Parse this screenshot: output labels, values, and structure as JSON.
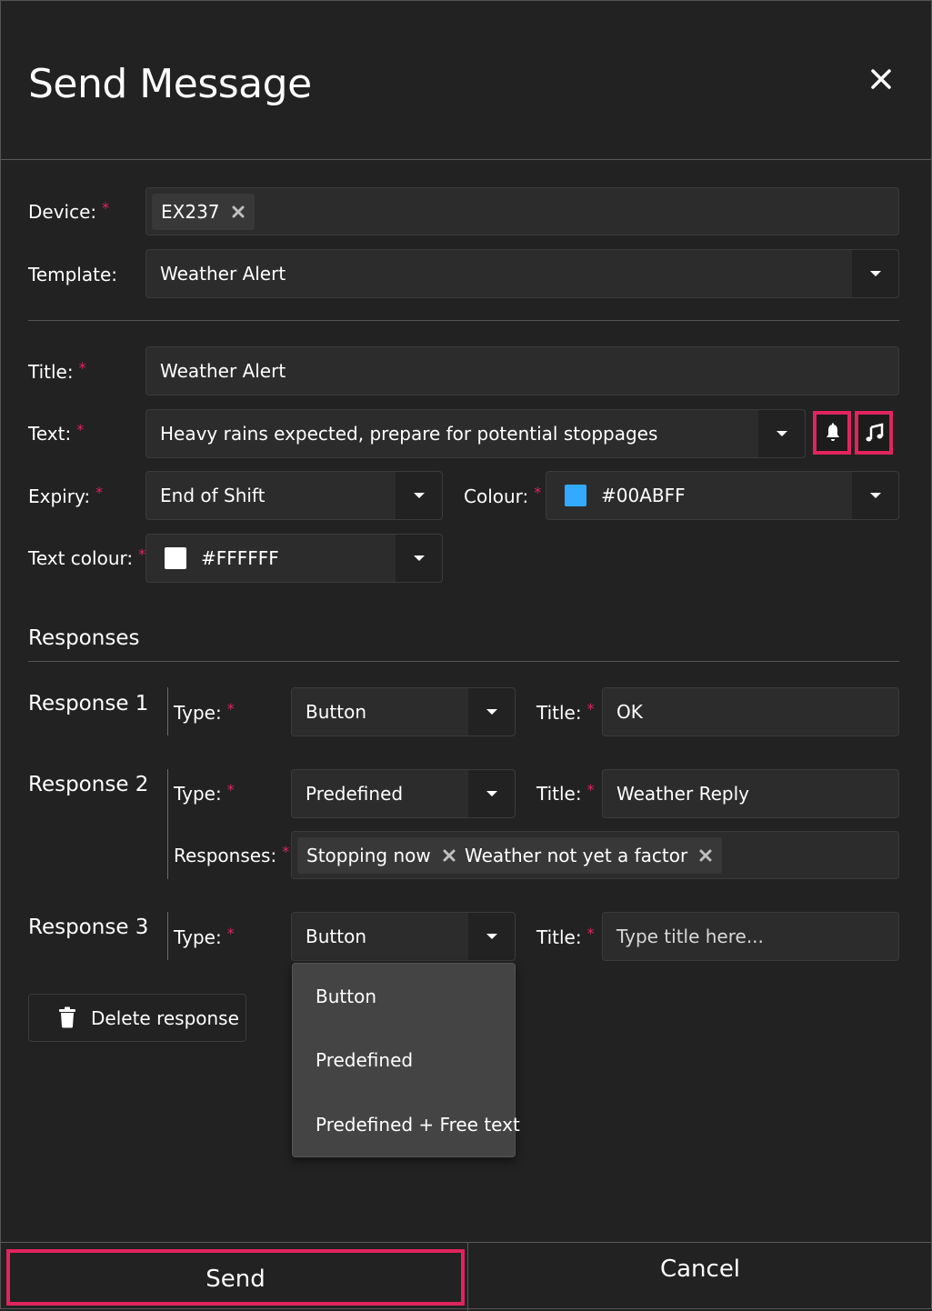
{
  "dialog": {
    "title": "Send Message",
    "close_icon": "close-icon"
  },
  "device": {
    "label": "Device:",
    "required_mark": "*",
    "chips": [
      "EX237"
    ]
  },
  "template": {
    "label": "Template:",
    "value": "Weather Alert"
  },
  "message": {
    "title_label": "Title:",
    "title_value": "Weather Alert",
    "text_label": "Text:",
    "text_value": "Heavy rains expected, prepare for potential stoppages",
    "alert_icon": "bell-icon",
    "sound_icon": "music-note-icon",
    "expiry_label": "Expiry:",
    "expiry_value": "End of Shift",
    "colour_label": "Colour:",
    "colour_value": "#00ABFF",
    "colour_swatch": "#33aaff",
    "text_colour_label": "Text colour:",
    "text_colour_value": "#FFFFFF",
    "text_colour_swatch": "#ffffff"
  },
  "responses": {
    "section_title": "Responses",
    "type_label": "Type:",
    "title_label": "Title:",
    "responses_label": "Responses:",
    "items": [
      {
        "name": "Response 1",
        "type": "Button",
        "title": "OK"
      },
      {
        "name": "Response 2",
        "type": "Predefined",
        "title": "Weather Reply",
        "chips": [
          "Stopping now",
          "Weather not yet a factor"
        ]
      },
      {
        "name": "Response 3",
        "type": "Button",
        "title_placeholder": "Type title here..."
      }
    ],
    "delete_label": "Delete response",
    "type_options": [
      "Button",
      "Predefined",
      "Predefined + Free text"
    ]
  },
  "footer": {
    "send_label": "Send",
    "cancel_label": "Cancel"
  },
  "colors": {
    "background": "#222222",
    "field_background": "#2c2c2c",
    "required": "#e0245e",
    "highlight": "#e0245e",
    "menu_background": "#444444"
  }
}
